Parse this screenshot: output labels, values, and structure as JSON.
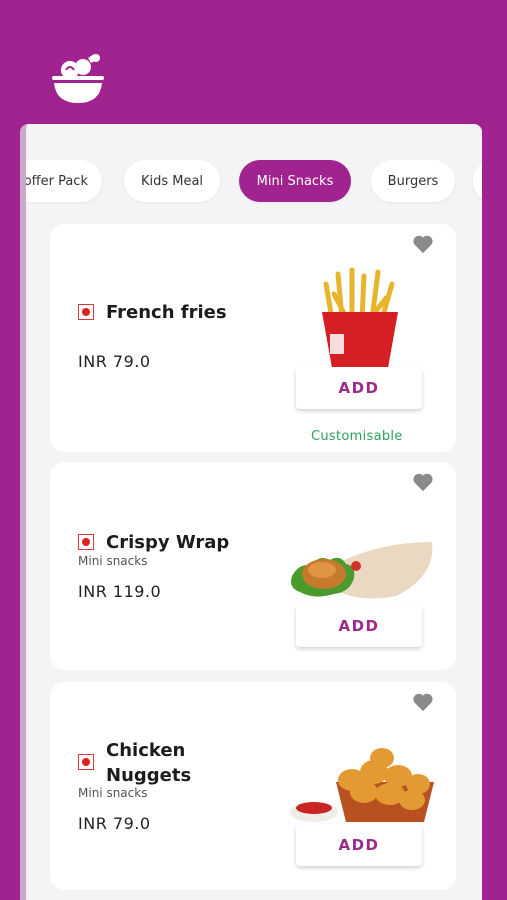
{
  "header": {
    "logo_icon": "salad-bowl-icon"
  },
  "categories": [
    {
      "label": "offer Pack",
      "active": false
    },
    {
      "label": "Kids Meal",
      "active": false
    },
    {
      "label": "Mini Snacks",
      "active": true
    },
    {
      "label": "Burgers",
      "active": false
    }
  ],
  "items": [
    {
      "name": "French fries",
      "subtitle": "",
      "price": "INR 79.0",
      "add_label": "ADD",
      "customisable_label": "Customisable",
      "image_icon": "french-fries-image"
    },
    {
      "name": "Crispy Wrap",
      "subtitle": "Mini snacks",
      "price": "INR 119.0",
      "add_label": "ADD",
      "image_icon": "crispy-wrap-image"
    },
    {
      "name_line1": "Chicken",
      "name_line2": "Nuggets",
      "subtitle": "Mini snacks",
      "price": "INR 79.0",
      "add_label": "ADD",
      "image_icon": "chicken-nuggets-image"
    }
  ],
  "colors": {
    "brand": "#a0238f",
    "veg_marker": "#e02020",
    "customisable": "#2e9e5b"
  }
}
